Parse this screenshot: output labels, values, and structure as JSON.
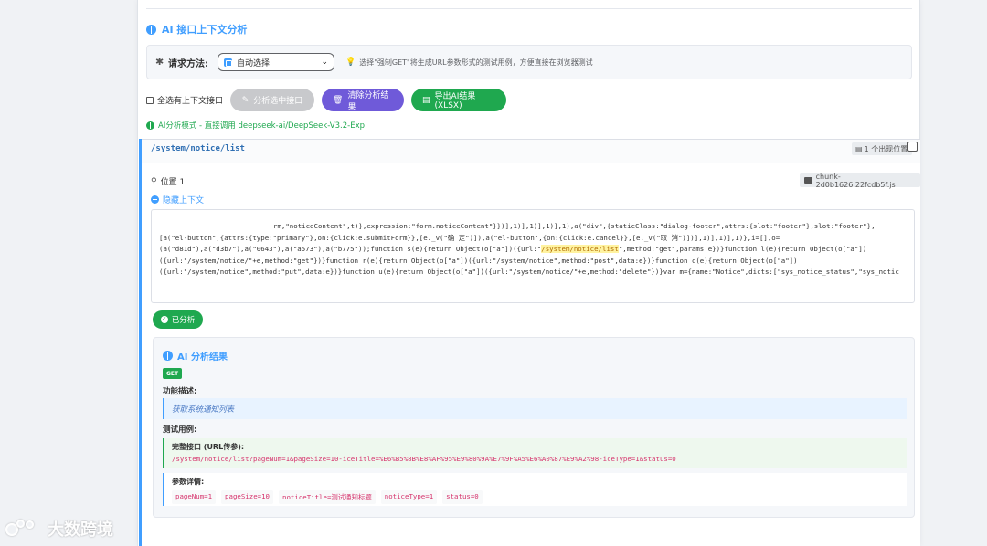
{
  "section": {
    "title": "AI 接口上下文分析"
  },
  "request": {
    "label": "请求方法:",
    "selected": "自动选择",
    "hint": "选择\"强制GET\"将生成URL参数形式的测试用例，方便直接在浏览器测试"
  },
  "toolbar": {
    "select_all": "全选有上下文接口",
    "analyze_selected": "分析选中接口",
    "clear_results": "清除分析结果",
    "export": "导出AI结果(XLSX)"
  },
  "mode": {
    "text": "AI分析模式 - 直接调用 deepseek-ai/DeepSeek-V3.2-Exp"
  },
  "endpoint": {
    "path": "/system/notice/list",
    "occurrences": "1 个出现位置",
    "location": "位置 1",
    "chunk": "chunk-2d0b1626.22fcdb5f.js",
    "toggle_context": "隐藏上下文",
    "code": {
      "line1": "rm,\"noticeContent\",t)},expression:\"form.noticeContent\"}})],1)],1)],1)],1),a(\"div\",{staticClass:\"dialog-footer\",attrs:{slot:\"footer\"},slot:\"footer\"},",
      "line2": "[a(\"el-button\",{attrs:{type:\"primary\"},on:{click:e.submitForm}},[e._v(\"确 定\")]),a(\"el-button\",{on:{click:e.cancel}},[e._v(\"取 消\")])],1)],1)],1)},i=[],o=",
      "line3a": "(a(\"d81d\"),a(\"d3b7\"),a(\"0643\"),a(\"a573\"),a(\"b775\"));function s(e){return Object(o[\"a\"])({url:\"",
      "line3hl": "/system/notice/list",
      "line3b": "\",method:\"get\",params:e})}function l(e){return Object(o[\"a\"])",
      "line4": "({url:\"/system/notice/\"+e,method:\"get\"})}function r(e){return Object(o[\"a\"])({url:\"/system/notice\",method:\"post\",data:e})}function c(e){return Object(o[\"a\"])",
      "line5": "({url:\"/system/notice\",method:\"put\",data:e})}function u(e){return Object(o[\"a\"])({url:\"/system/notice/\"+e,method:\"delete\"})}var m={name:\"Notice\",dicts:[\"sys_notice_status\",\"sys_notic"
    },
    "status": "已分析"
  },
  "result": {
    "title": "AI 分析结果",
    "method": "GET",
    "desc_label": "功能描述:",
    "desc": "获取系统通知列表",
    "tc_label": "测试用例:",
    "full_label": "完整接口 (URL传参):",
    "full_url": "/system/notice/list?pageNum=1&pageSize=10-iceTitle=%E6%B5%8B%E8%AF%95%E9%80%9A%E7%9F%A5%E6%A0%87%E9%A2%98-iceType=1&status=0",
    "param_label": "参数详情:",
    "params": [
      "pageNum=1",
      "pageSize=10",
      "noticeTitle=测试通知标题",
      "noticeType=1",
      "status=0"
    ]
  },
  "watermark": {
    "text": "大数跨境"
  },
  "colors": {
    "accent": "#409eff",
    "green": "#1fa84f",
    "purple": "#6f5ad9"
  }
}
